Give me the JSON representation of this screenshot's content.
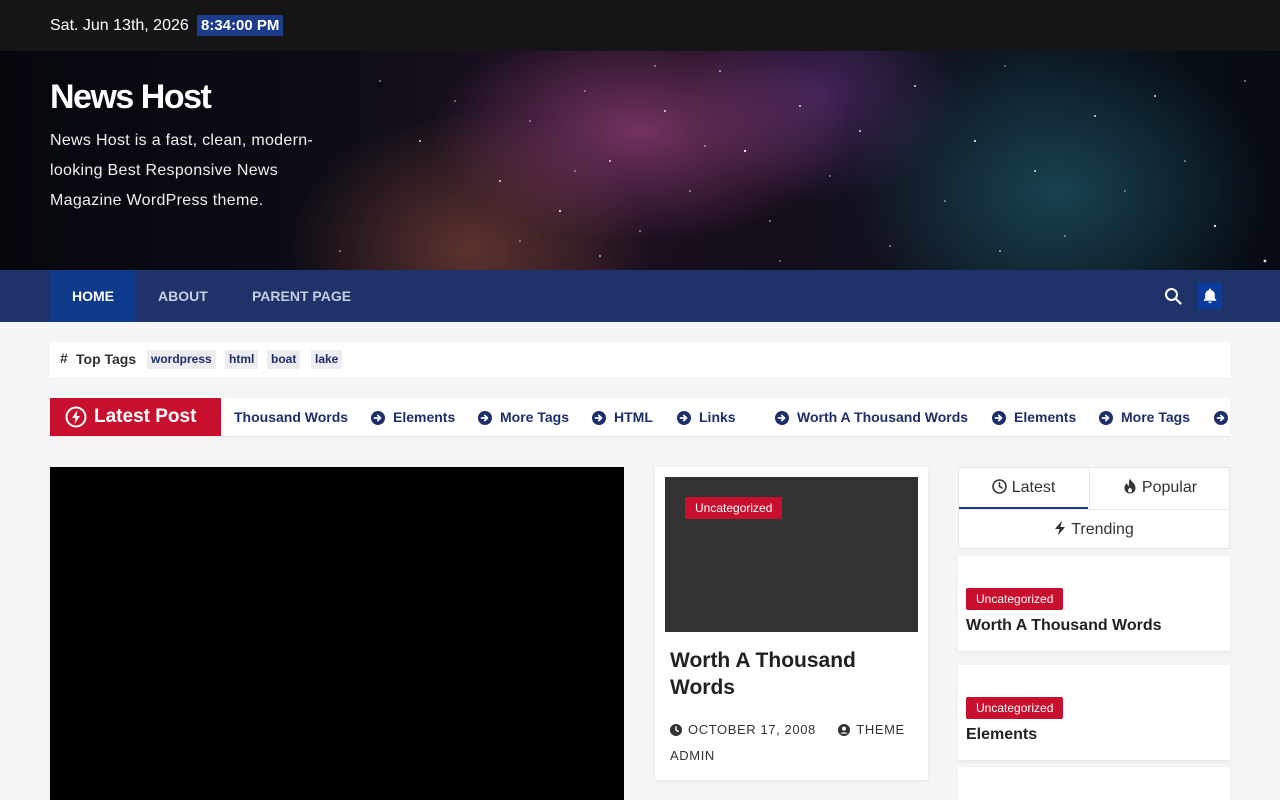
{
  "topbar": {
    "date": "Sat. Jun 13th, 2026",
    "time": "8:34:00 PM"
  },
  "header": {
    "title": "News Host",
    "description": "News Host is a fast, clean, modern-looking Best Responsive News Magazine WordPress theme."
  },
  "nav": {
    "items": [
      {
        "label": "Home"
      },
      {
        "label": "About"
      },
      {
        "label": "Parent Page"
      }
    ]
  },
  "top_tags": {
    "label": "Top Tags",
    "tags": [
      "wordpress",
      "html",
      "boat",
      "lake"
    ]
  },
  "ticker": {
    "label": "Latest Post",
    "items": [
      "Thousand Words",
      "Elements",
      "More Tags",
      "HTML",
      "Links",
      "Worth A Thousand Words",
      "Elements",
      "More Tags"
    ]
  },
  "featured_card": {
    "category": "Uncategorized",
    "title": "Worth A Thousand Words",
    "date": "October 17, 2008",
    "author": "Theme Admin"
  },
  "sidebar": {
    "tabs": [
      {
        "label": "Latest"
      },
      {
        "label": "Popular"
      },
      {
        "label": "Trending"
      }
    ],
    "posts": [
      {
        "category": "Uncategorized",
        "title": "Worth A Thousand Words"
      },
      {
        "category": "Uncategorized",
        "title": "Elements"
      }
    ]
  },
  "colors": {
    "accent_red": "#c8102e",
    "nav_blue": "#20326a",
    "active_blue": "#0e3a8c"
  }
}
